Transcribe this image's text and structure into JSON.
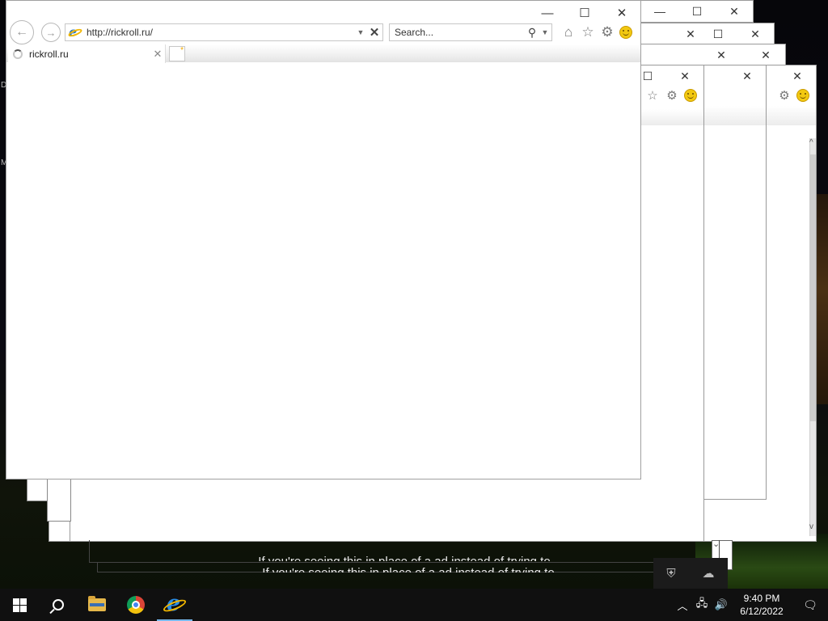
{
  "browser": {
    "url": "http://rickroll.ru/",
    "search_placeholder": "Search...",
    "tab_title": "rickroll.ru",
    "new_tab_glyph": "*"
  },
  "ghost_windows": {
    "ticker_text_1": "If you're seeing this in place of a ad instead of trying to",
    "ticker_text_2": "If you're seeing this in place of a ad instead of trying to"
  },
  "taskbar": {
    "apps": [
      {
        "name": "file-explorer",
        "icon": "folder-icon"
      },
      {
        "name": "google-chrome",
        "icon": "chrome-icon"
      },
      {
        "name": "internet-explorer",
        "icon": "ie-icon",
        "active": true
      }
    ],
    "clock_time": "9:40 PM",
    "clock_date": "6/12/2022"
  },
  "icons": {
    "back": "←",
    "forward": "→",
    "home": "⌂",
    "favorites": "☆",
    "settings": "⚙",
    "close": "✕",
    "maximize": "☐",
    "minimize": "—",
    "search": "⚲"
  }
}
